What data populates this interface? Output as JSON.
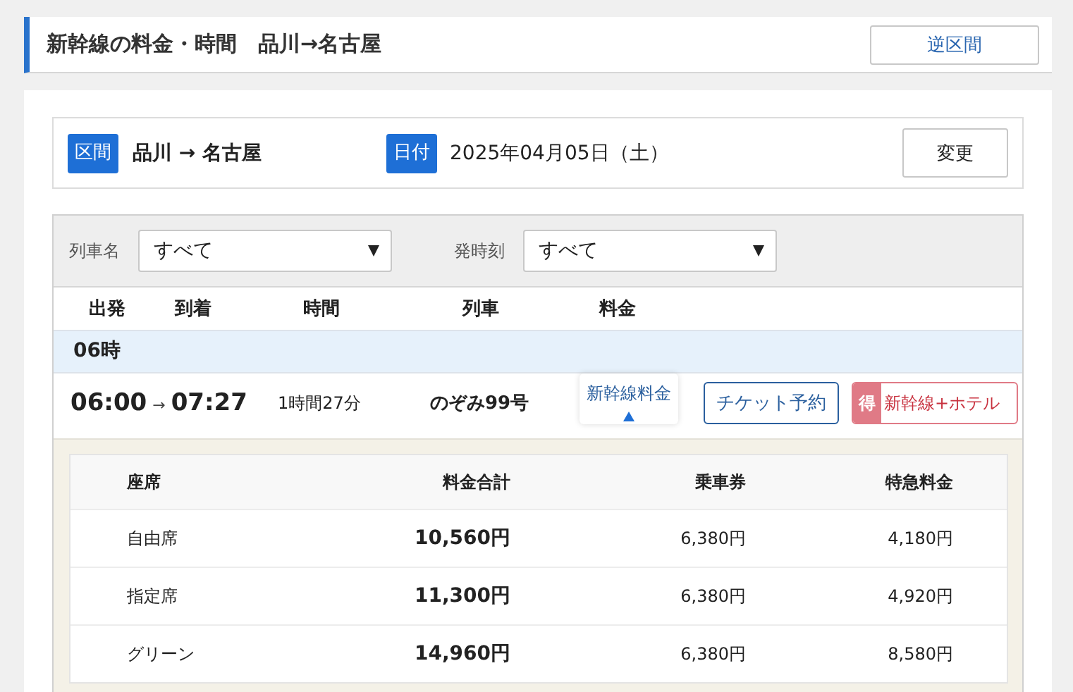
{
  "header": {
    "title": "新幹線の料金・時間　品川→名古屋",
    "reverse_button": "逆区間"
  },
  "search": {
    "section_label": "区間",
    "route": "品川 → 名古屋",
    "date_label": "日付",
    "date": "2025年04月05日（土）",
    "change_button": "変更"
  },
  "filters": [
    {
      "label": "列車名",
      "value": "すべて"
    },
    {
      "label": "発時刻",
      "value": "すべて"
    }
  ],
  "columns": [
    "出発",
    "到着",
    "時間",
    "列車",
    "料金"
  ],
  "groups": [
    {
      "hour": "06時",
      "trains": [
        {
          "departure": "06:00",
          "arrow": "→",
          "arrival": "07:27",
          "duration": "1時間27分",
          "name": "のぞみ99号",
          "fare_button": "新幹線料金",
          "expanded": true,
          "ticket_button": "チケット予約",
          "deal_badge": "得",
          "hotel_button": "新幹線+ホテル",
          "fares": {
            "columns": [
              "座席",
              "料金合計",
              "乗車券",
              "特急料金"
            ],
            "rows": [
              {
                "seat": "自由席",
                "total": "10,560円",
                "base": "6,380円",
                "express": "4,180円"
              },
              {
                "seat": "指定席",
                "total": "11,300円",
                "base": "6,380円",
                "express": "4,920円"
              },
              {
                "seat": "グリーン",
                "total": "14,960円",
                "base": "6,380円",
                "express": "8,580円"
              }
            ]
          }
        }
      ]
    }
  ]
}
